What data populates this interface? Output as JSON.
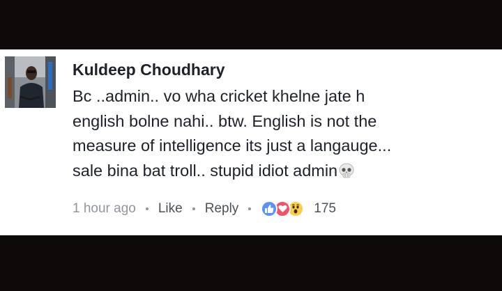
{
  "comment": {
    "author": "Kuldeep Choudhary",
    "lines": [
      "Bc ..admin.. vo wha cricket khelne jate h",
      "english bolne nahi.. btw. English is not the",
      "measure of intelligence its just a langauge...",
      "sale bina bat troll.. stupid idiot admin"
    ],
    "trailing_emoji": "skull-icon"
  },
  "meta": {
    "timestamp": "1 hour ago",
    "like_label": "Like",
    "reply_label": "Reply",
    "reaction_count": "175",
    "reactions": [
      "like-icon",
      "love-icon",
      "wow-icon"
    ]
  },
  "colors": {
    "background": "#0e0a0a",
    "card": "#ffffff",
    "text": "#1d2129",
    "meta_text": "#90949c",
    "like_blue": "#5890ff",
    "love_red": "#f25268",
    "wow_yellow": "#fccd48"
  }
}
